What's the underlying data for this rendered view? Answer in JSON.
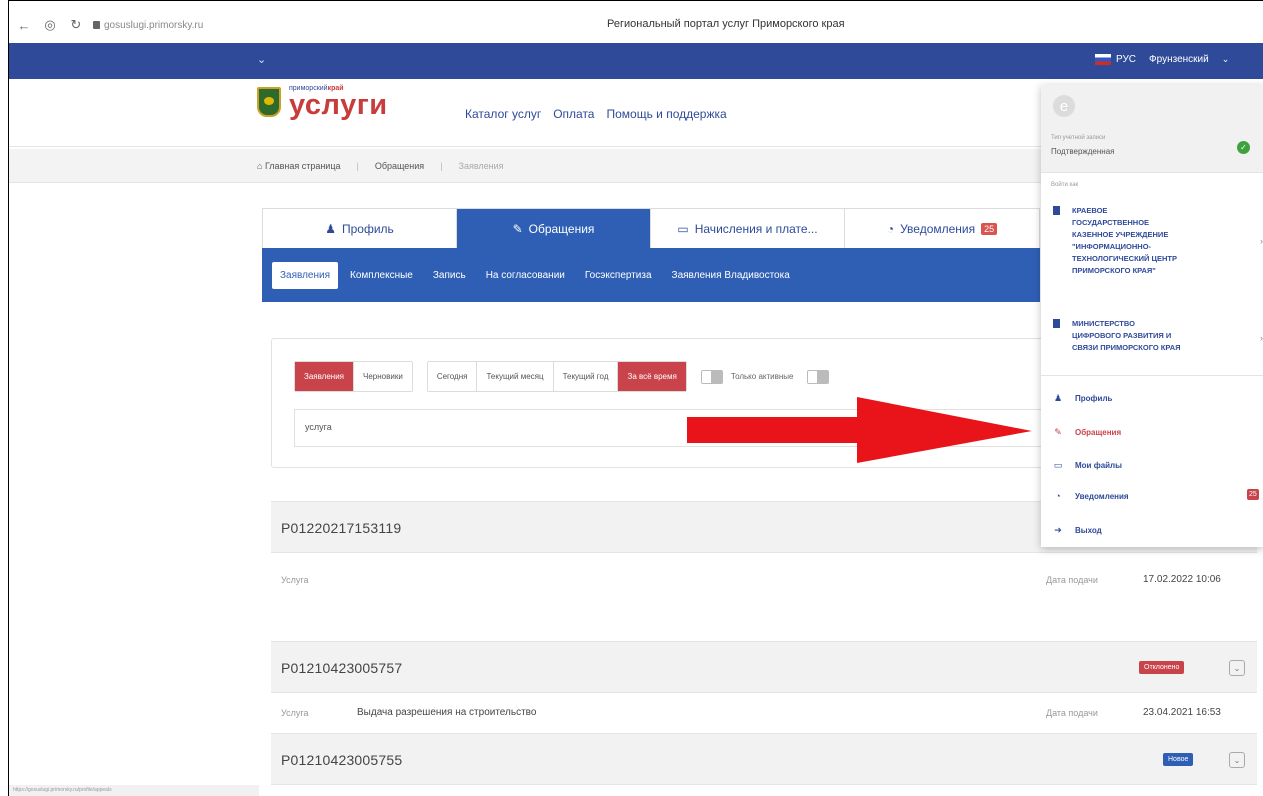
{
  "browser": {
    "url": "gosuslugi.primorsky.ru",
    "page_title": "Региональный портал услуг Приморского края"
  },
  "topbar": {
    "lang": "РУС",
    "user": "Фрунзенский"
  },
  "logo": {
    "small_a": "приморский",
    "small_b": "край",
    "big": "услуги"
  },
  "mainnav": [
    "Каталог услуг",
    "Оплата",
    "Помощь и поддержка"
  ],
  "breadcrumb": [
    "Главная страница",
    "Обращения",
    "Заявления"
  ],
  "tabs": [
    {
      "label": "Профиль",
      "icon": "user-icon"
    },
    {
      "label": "Обращения",
      "icon": "edit-icon"
    },
    {
      "label": "Начисления и плате...",
      "icon": "card-icon"
    },
    {
      "label": "Уведомления",
      "icon": "chat-icon",
      "badge": "25"
    }
  ],
  "subtabs": [
    "Заявления",
    "Комплексные",
    "Запись",
    "На согласовании",
    "Госэкспертиза",
    "Заявления Владивостока"
  ],
  "filter": {
    "type_buttons": [
      "Заявления",
      "Черновики"
    ],
    "period_buttons": [
      "Сегодня",
      "Текущий месяц",
      "Текущий год",
      "За всё время"
    ],
    "toggle_label": "Только активные",
    "search_value": "услуга"
  },
  "list": {
    "service_label": "Услуга",
    "date_label": "Дата подачи",
    "items": [
      {
        "number": "P01220217153119",
        "service": "",
        "date": "17.02.2022 10:06",
        "status": ""
      },
      {
        "number": "P01210423005757",
        "service": "Выдача разрешения на строительство",
        "date": "23.04.2021 16:53",
        "status": "Отклонено"
      },
      {
        "number": "P01210423005755",
        "service": "",
        "date": "",
        "status": "Новое"
      }
    ]
  },
  "dropdown": {
    "avatar_letter": "e",
    "account_label": "Тип учетной записи",
    "account_type": "Подтвержденная",
    "workplace_label": "Войти как",
    "orgs": [
      [
        "КРАЕВОЕ",
        "ГОСУДАРСТВЕННОЕ",
        "КАЗЕННОЕ УЧРЕЖДЕНИЕ",
        "\"ИНФОРМАЦИОННО-",
        "ТЕХНОЛОГИЧЕСКИЙ ЦЕНТР",
        "ПРИМОРСКОГО КРАЯ\""
      ],
      [
        "МИНИСТЕРСТВО",
        "ЦИФРОВОГО РАЗВИТИЯ И",
        "СВЯЗИ ПРИМОРСКОГО КРАЯ"
      ]
    ],
    "menu": [
      "Профиль",
      "Обращения",
      "Мои файлы",
      "Уведомления",
      "Выход"
    ],
    "notifications_badge": "25"
  },
  "statusbar": "https://gosuslugi.primorsky.ru/profile/appeals",
  "colors": {
    "primary": "#2f4a99",
    "accent": "#2f5fb5",
    "red": "#c9434b",
    "arrow": "#e8141a"
  }
}
